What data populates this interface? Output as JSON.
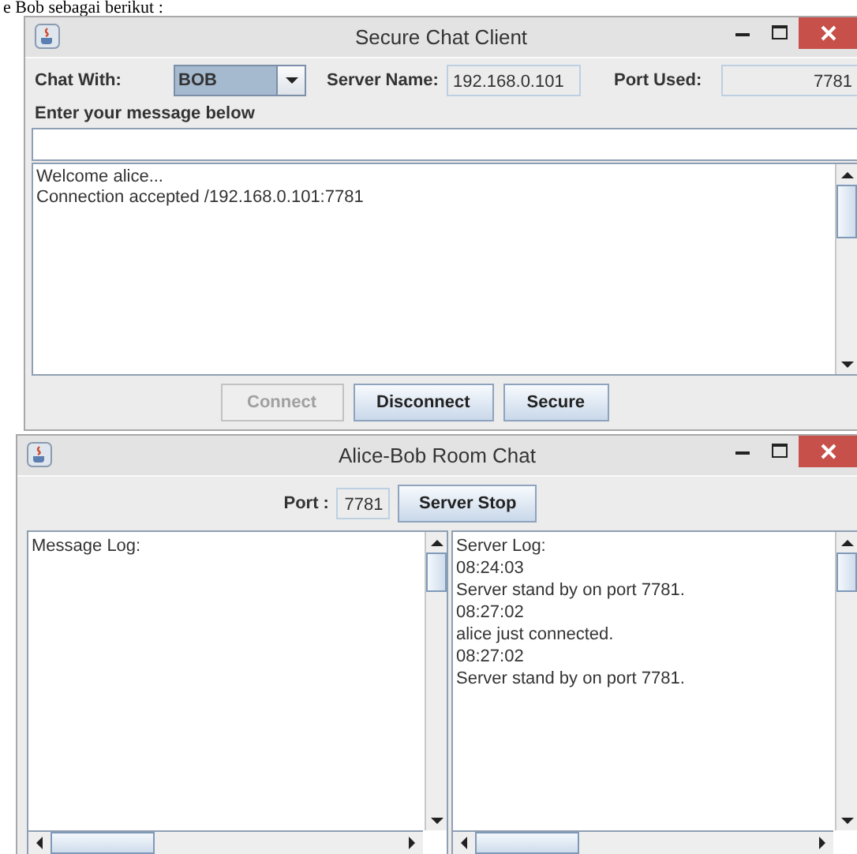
{
  "caption": "e Bob sebagai berikut :",
  "client_window": {
    "title": "Secure Chat Client",
    "chat_with_label": "Chat With:",
    "chat_with_value": "BOB",
    "server_name_label": "Server Name:",
    "server_name_value": "192.168.0.101",
    "port_label": "Port Used:",
    "port_value": "7781",
    "message_label": "Enter your message below",
    "chat_log": [
      "Welcome alice...",
      "Connection accepted /192.168.0.101:7781"
    ],
    "buttons": [
      {
        "label": "Connect",
        "disabled": true
      },
      {
        "label": "Disconnect",
        "disabled": false
      },
      {
        "label": "Secure",
        "disabled": false
      }
    ]
  },
  "server_window": {
    "title": "Alice-Bob Room Chat",
    "port_label": "Port :",
    "port_value": "7781",
    "button": "Server Stop",
    "message_log": [
      "Message Log:"
    ],
    "server_log": [
      "Server Log:",
      "08:24:03",
      "Server stand by on port 7781.",
      "08:27:02",
      "alice just connected.",
      "08:27:02",
      "Server stand by on port 7781."
    ]
  }
}
